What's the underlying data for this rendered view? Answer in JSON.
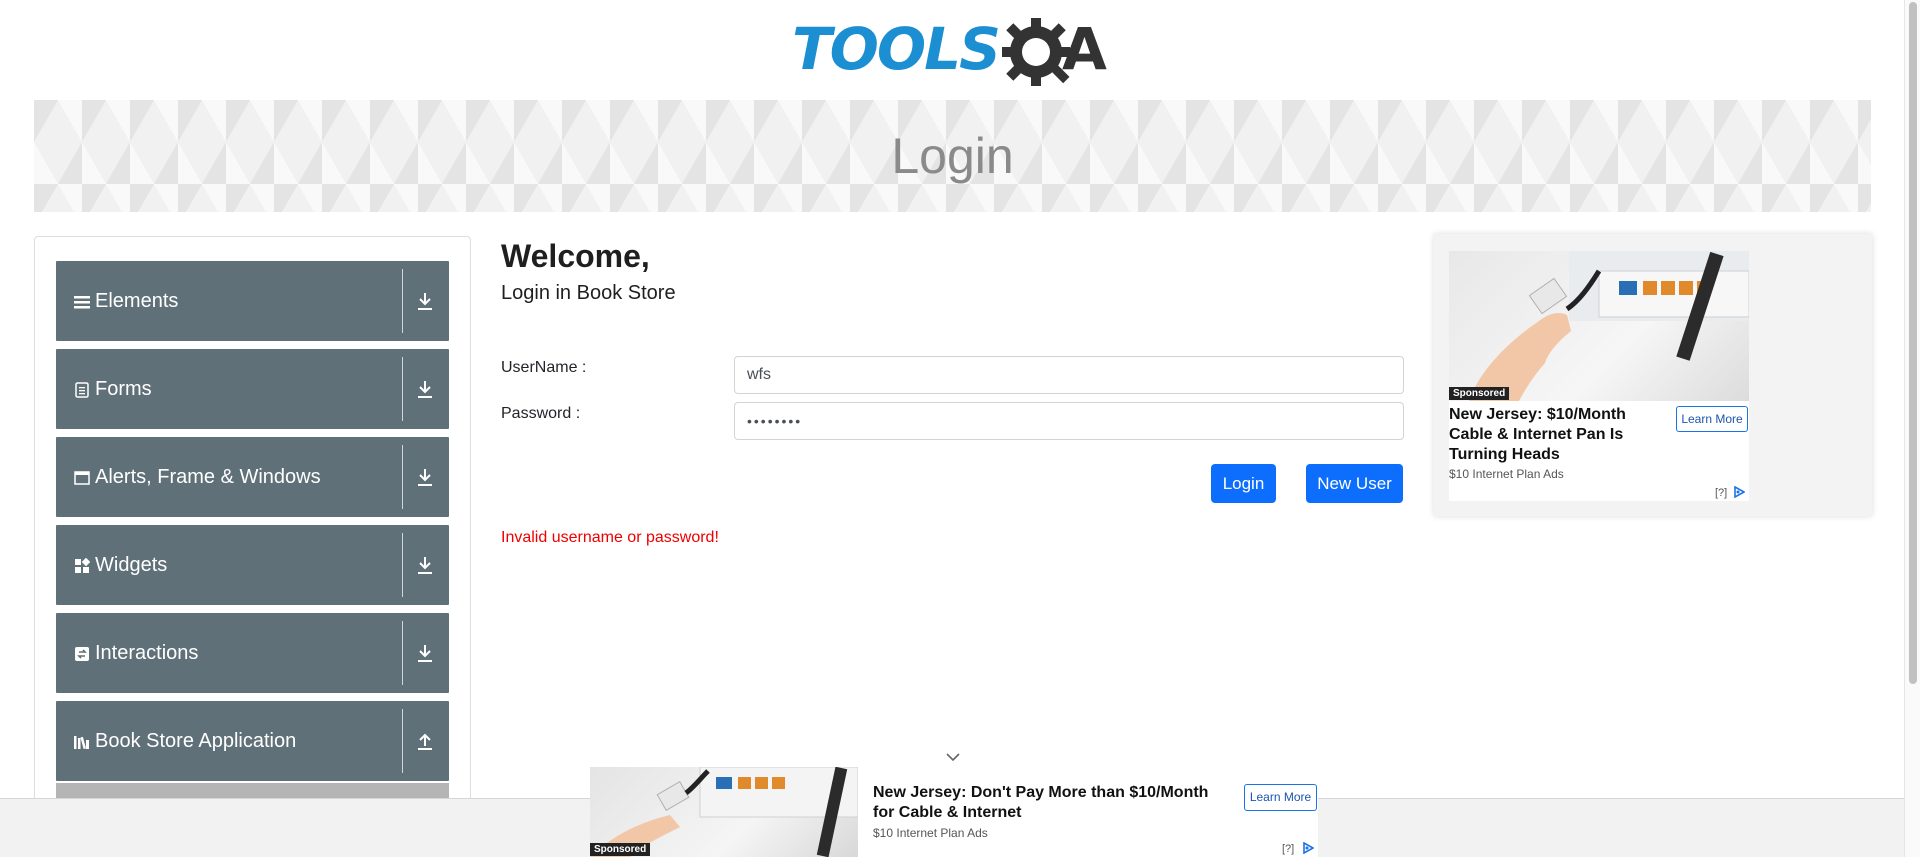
{
  "header": {
    "logo_text": "TOOLS",
    "logo_letter": "A",
    "banner_title": "Login"
  },
  "sidebar": {
    "groups": [
      {
        "label": "Elements",
        "icon": "hamburger-icon",
        "expanded": false
      },
      {
        "label": "Forms",
        "icon": "document-icon",
        "expanded": false
      },
      {
        "label": "Alerts, Frame & Windows",
        "icon": "window-icon",
        "expanded": false
      },
      {
        "label": "Widgets",
        "icon": "widgets-icon",
        "expanded": false
      },
      {
        "label": "Interactions",
        "icon": "interactions-icon",
        "expanded": false
      },
      {
        "label": "Book Store Application",
        "icon": "books-icon",
        "expanded": true
      }
    ]
  },
  "main": {
    "welcome": "Welcome,",
    "subtitle": "Login in Book Store",
    "username_label": "UserName :",
    "username_value": "wfs",
    "password_label": "Password :",
    "password_value": "••••••••",
    "login_button": "Login",
    "new_user_button": "New User",
    "error_message": "Invalid username or password!"
  },
  "ad_right": {
    "sponsored": "Sponsored",
    "title": "New Jersey: $10/Month Cable & Internet Pan Is Turning Heads",
    "source": "$10 Internet Plan Ads",
    "cta": "Learn More",
    "info": "[?]"
  },
  "ad_bottom": {
    "sponsored": "Sponsored",
    "title": "New Jersey: Don't Pay More than $10/Month for Cable & Internet",
    "source": "$10 Internet Plan Ads",
    "cta": "Learn More",
    "info": "[?]"
  },
  "colors": {
    "accent": "#0d6efd",
    "sidebar_group": "#607078",
    "error": "#ee0000",
    "logo_blue": "#1b8fd1"
  }
}
